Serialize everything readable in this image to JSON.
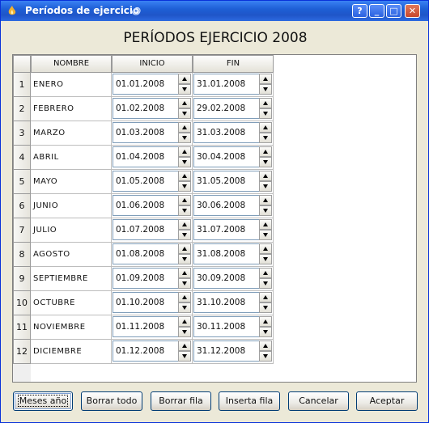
{
  "window": {
    "title": "Períodos de ejercicio",
    "controls": {
      "help": "?",
      "minimize": "_",
      "maximize": "□",
      "close": "✕"
    }
  },
  "heading": "PERÍODOS EJERCICIO 2008",
  "table": {
    "columns": [
      "NOMBRE",
      "INICIO",
      "FIN"
    ],
    "rows": [
      {
        "num": "1",
        "name": "ENERO",
        "start": "01.01.2008",
        "end": "31.01.2008"
      },
      {
        "num": "2",
        "name": "FEBRERO",
        "start": "01.02.2008",
        "end": "29.02.2008"
      },
      {
        "num": "3",
        "name": "MARZO",
        "start": "01.03.2008",
        "end": "31.03.2008"
      },
      {
        "num": "4",
        "name": "ABRIL",
        "start": "01.04.2008",
        "end": "30.04.2008"
      },
      {
        "num": "5",
        "name": "MAYO",
        "start": "01.05.2008",
        "end": "31.05.2008"
      },
      {
        "num": "6",
        "name": "JUNIO",
        "start": "01.06.2008",
        "end": "30.06.2008"
      },
      {
        "num": "7",
        "name": "JULIO",
        "start": "01.07.2008",
        "end": "31.07.2008"
      },
      {
        "num": "8",
        "name": "AGOSTO",
        "start": "01.08.2008",
        "end": "31.08.2008"
      },
      {
        "num": "9",
        "name": "SEPTIEMBRE",
        "start": "01.09.2008",
        "end": "30.09.2008"
      },
      {
        "num": "10",
        "name": "OCTUBRE",
        "start": "01.10.2008",
        "end": "31.10.2008"
      },
      {
        "num": "11",
        "name": "NOVIEMBRE",
        "start": "01.11.2008",
        "end": "30.11.2008"
      },
      {
        "num": "12",
        "name": "DICIEMBRE",
        "start": "01.12.2008",
        "end": "31.12.2008"
      }
    ]
  },
  "buttons": {
    "months": "Meses año",
    "clear_all": "Borrar todo",
    "delete_row": "Borrar fila",
    "insert_row": "Inserta fila",
    "cancel": "Cancelar",
    "accept": "Aceptar"
  },
  "icons": {
    "app": "flame-icon",
    "title_extra": "spiral-icon"
  },
  "colors": {
    "titlebar": "#245edb",
    "window_bg": "#ece9d8",
    "field_border": "#7f9db9"
  }
}
